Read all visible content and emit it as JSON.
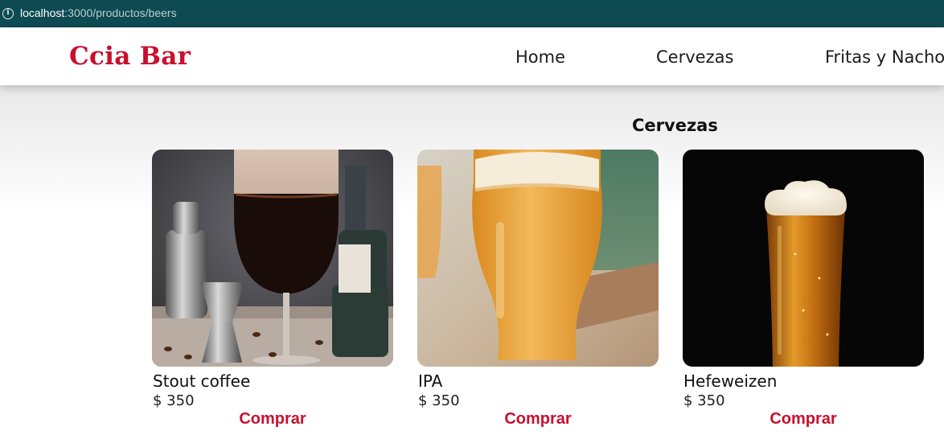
{
  "browser": {
    "url_host": "localhost",
    "url_path": ":3000/productos/beers",
    "info_icon": "info-icon"
  },
  "header": {
    "logo": "Ccia Bar",
    "nav": [
      {
        "label": "Home"
      },
      {
        "label": "Cervezas"
      },
      {
        "label": "Fritas y Nacho"
      }
    ]
  },
  "main": {
    "title": "Cervezas",
    "products": [
      {
        "name": "Stout coffee",
        "price": "$ 350",
        "button": "Comprar",
        "image": "stout-coffee-photo"
      },
      {
        "name": "IPA",
        "price": "$ 350",
        "button": "Comprar",
        "image": "ipa-photo"
      },
      {
        "name": "Hefeweizen",
        "price": "$ 350",
        "button": "Comprar",
        "image": "hefeweizen-photo"
      }
    ]
  },
  "colors": {
    "brand": "#c8102e",
    "urlbar": "#0d4a52"
  }
}
